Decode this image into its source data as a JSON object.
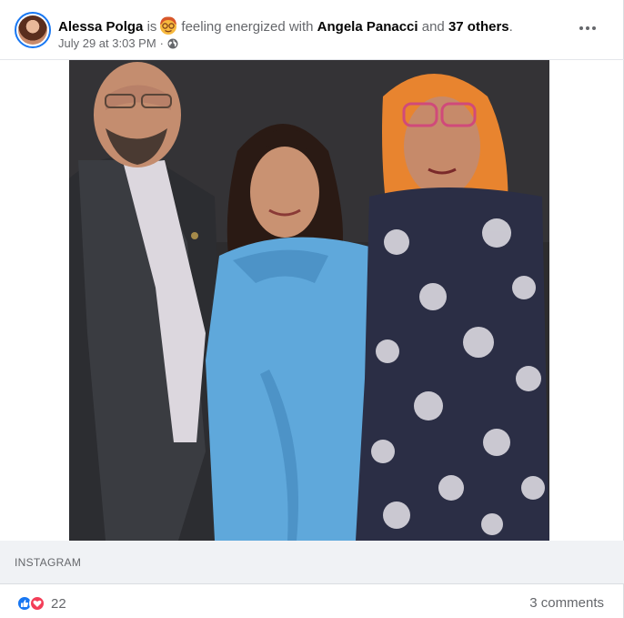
{
  "post": {
    "author": "Alessa Polga",
    "verb": "is",
    "feeling_text": "feeling energized with",
    "tagged_person": "Angela Panacci",
    "connector": "and",
    "others": "37 others",
    "end_punct": ".",
    "timestamp": "July 29 at 3:03 PM",
    "separator": "·",
    "audience_icon": "globe-icon",
    "menu_icon": "more-options-icon"
  },
  "link": {
    "source": "INSTAGRAM"
  },
  "footer": {
    "reaction_count": "22",
    "comments_label": "3 comments",
    "reaction_icons": [
      "like-icon",
      "love-icon"
    ]
  },
  "colors": {
    "link_blue": "#1877f2",
    "love_red": "#f33e58",
    "secondary_text": "#65676b",
    "bar_bg": "#f0f2f5"
  }
}
